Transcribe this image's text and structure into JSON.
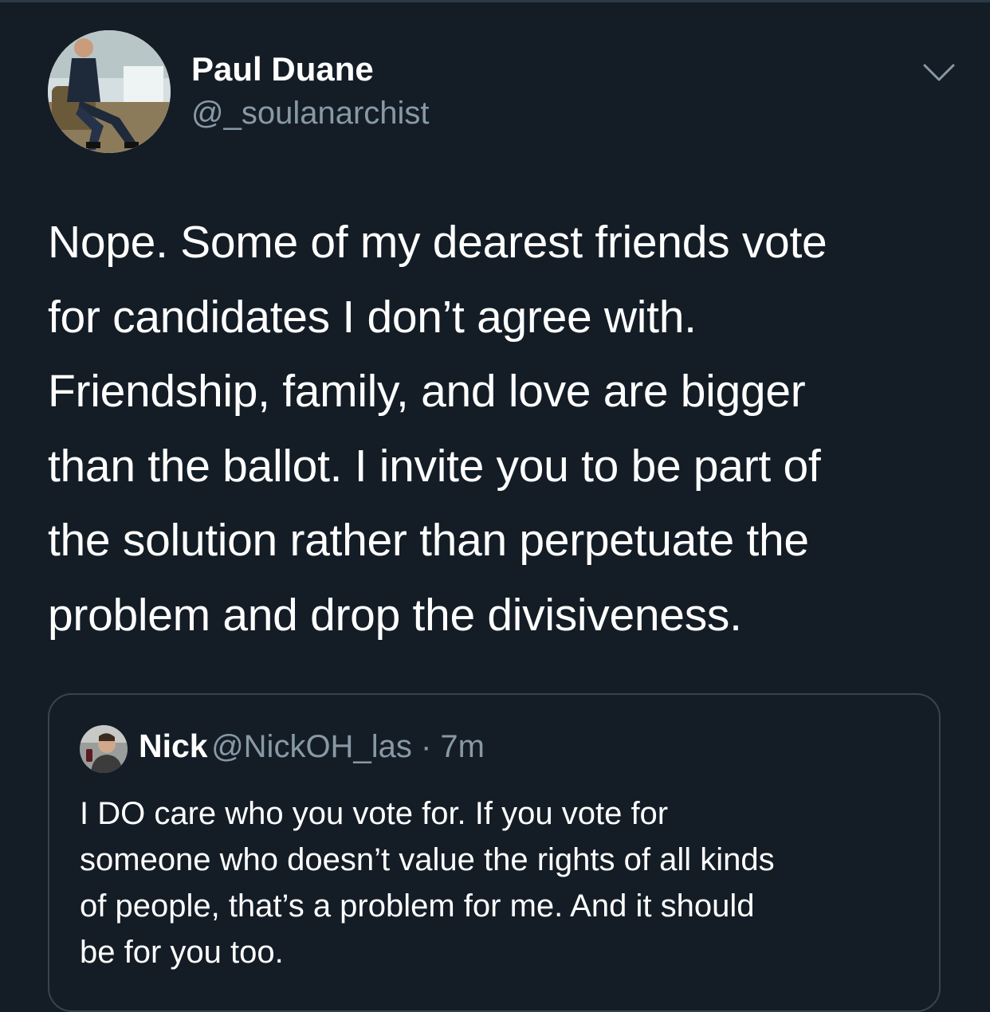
{
  "tweet": {
    "author": {
      "name": "Paul Duane",
      "handle": "@_soulanarchist"
    },
    "text_lines": [
      "Nope. Some of my dearest friends vote",
      "for candidates I don’t agree with.",
      "Friendship, family, and love are bigger",
      "than the ballot. I invite you to be part of",
      "the solution rather than perpetuate the",
      "problem and drop the divisiveness."
    ],
    "more_icon": "chevron-down-icon"
  },
  "quoted_tweet": {
    "author": {
      "name": "Nick",
      "handle": "@NickOH_las"
    },
    "separator": "·",
    "time": "7m",
    "text_lines": [
      "I DO care who you vote for. If you vote for",
      "someone who doesn’t value the rights of all kinds",
      "of people, that’s a problem for me. And it should",
      "be for you too."
    ]
  },
  "colors": {
    "background": "#141d26",
    "secondary_text": "#8899a6",
    "border": "#38444d"
  }
}
